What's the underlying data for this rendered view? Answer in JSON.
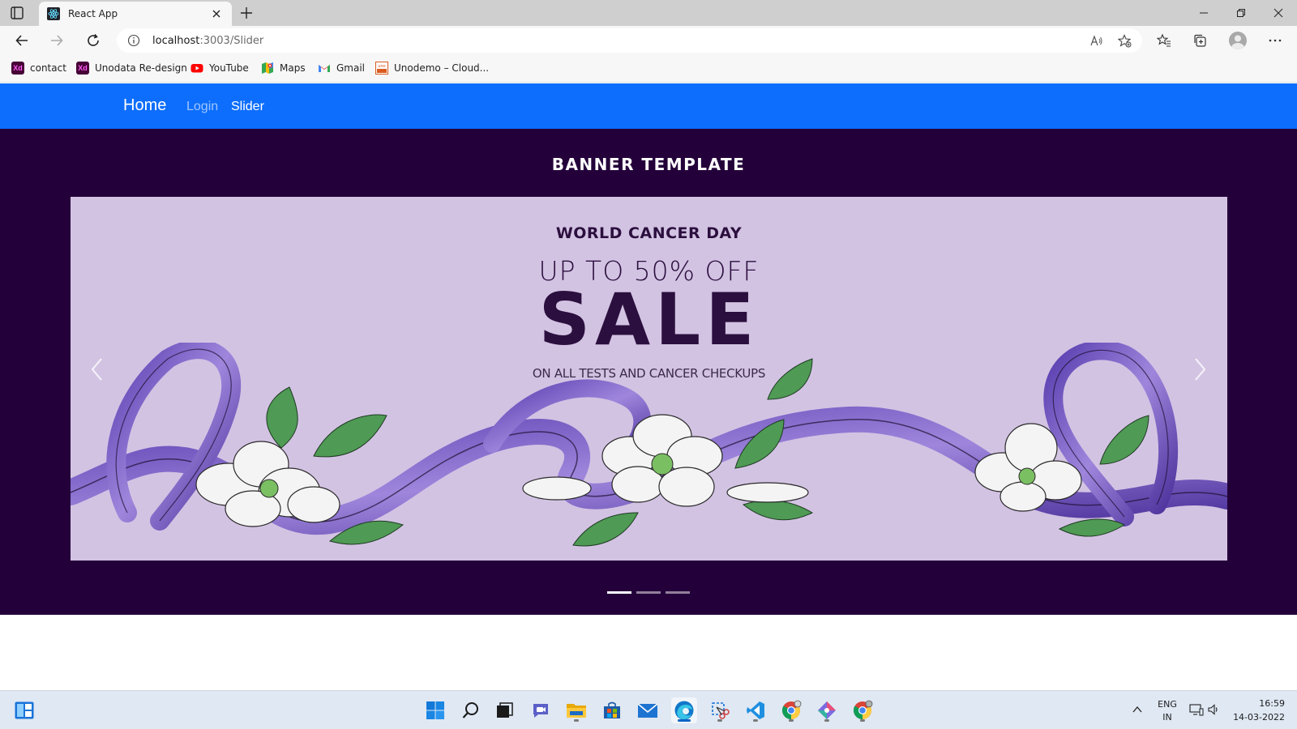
{
  "browser": {
    "tab": {
      "title": "React App"
    },
    "address": {
      "host": "localhost",
      "path": ":3003/Slider"
    },
    "bookmarks": [
      {
        "label": "contact",
        "icon": "adobe-xd-icon"
      },
      {
        "label": "Unodata Re-design",
        "icon": "adobe-xd-icon"
      },
      {
        "label": "YouTube",
        "icon": "youtube-icon"
      },
      {
        "label": "Maps",
        "icon": "maps-icon"
      },
      {
        "label": "Gmail",
        "icon": "gmail-icon"
      },
      {
        "label": "Unodemo – Cloud...",
        "icon": "unodemo-icon"
      }
    ]
  },
  "navbar": {
    "brand": "Home",
    "links": [
      {
        "label": "Login",
        "active": false
      },
      {
        "label": "Slider",
        "active": true
      }
    ],
    "color": "#0d6efd"
  },
  "banner": {
    "heading": "BANNER TEMPLATE",
    "background": "#24003a",
    "slide": {
      "kicker": "WORLD CANCER DAY",
      "offer": "UP TO 50% OFF",
      "sale": "SALE",
      "subtext": "ON ALL TESTS AND CANCER CHECKUPS",
      "background": "#d3c3e3"
    },
    "indicators": {
      "count": 3,
      "active": 0
    }
  },
  "taskbar": {
    "lang_line1": "ENG",
    "lang_line2": "IN",
    "time": "16:59",
    "date": "14-03-2022"
  }
}
